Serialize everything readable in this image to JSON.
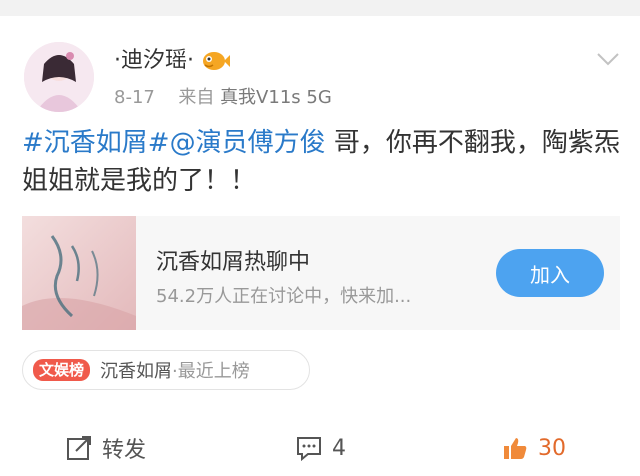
{
  "post": {
    "author": "·迪汐瑶·",
    "date": "8-17",
    "source_prefix": "来自",
    "device": "真我V11s 5G",
    "content": {
      "hashtag": "#沉香如屑#",
      "mention": "@演员傅方俊",
      "text": " 哥，你再不翻我，陶紫炁姐姐就是我的了！！"
    }
  },
  "card": {
    "title": "沉香如屑热聊中",
    "subtitle": "54.2万人正在讨论中，快来加...",
    "button": "加入"
  },
  "rank": {
    "badge": "文娱榜",
    "topic": "沉香如屑",
    "status": "·最近上榜"
  },
  "actions": {
    "share_label": "转发",
    "comment_count": "4",
    "like_count": "30"
  },
  "colors": {
    "accent_blue": "#2a7ac9",
    "join_button": "#4da3f0",
    "like_orange": "#e26a2b",
    "rank_badge": "#f05a4b"
  },
  "icons": {
    "verified": "fish-badge-icon",
    "more": "chevron-down-icon",
    "share": "share-icon",
    "comment": "comment-icon",
    "like": "thumbs-up-icon"
  }
}
